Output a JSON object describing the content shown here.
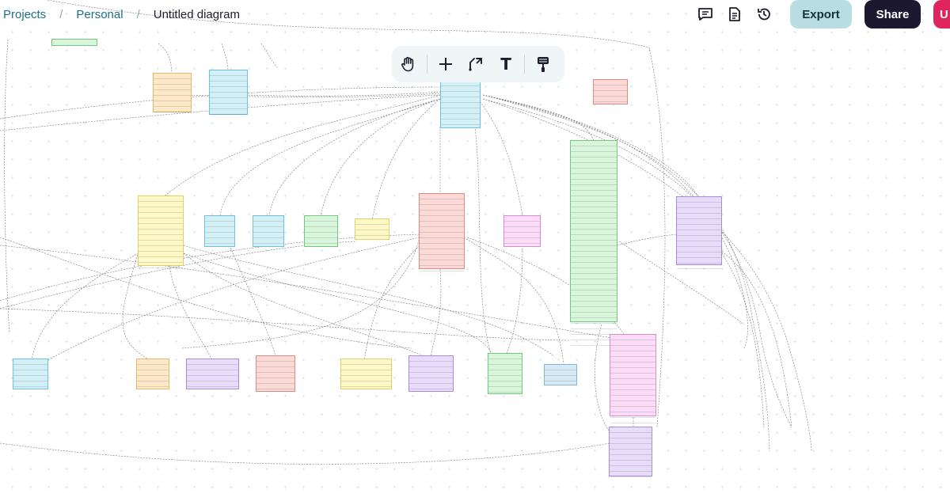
{
  "breadcrumb": {
    "projects": "Projects",
    "separator": "/",
    "personal": "Personal",
    "title": "Untitled diagram"
  },
  "actions": {
    "comments_icon": "comment-icon",
    "notes_icon": "document-icon",
    "history_icon": "history-icon",
    "export_label": "Export",
    "share_label": "Share",
    "user_label": "U"
  },
  "toolbar": {
    "tools": [
      "hand-icon",
      "plus-icon",
      "connector-icon",
      "text-icon",
      "paint-icon"
    ],
    "text_glyph": "T"
  },
  "colors": {
    "export_bg": "#b8dde3",
    "share_bg": "#1b1830",
    "user_bg": "#e0245e",
    "crumb_link": "#1f6f8b",
    "table_palette": [
      "#fde9c8",
      "#d4f0f7",
      "#fbd9d6",
      "#d9f5dc",
      "#fdf8c6",
      "#e8dcfb",
      "#fcdcf6",
      "#d6eaf5"
    ]
  },
  "tables": [
    {
      "id": "t1",
      "color": "#fde9c8",
      "border": "#e8b56c",
      "rows": 7
    },
    {
      "id": "t2",
      "color": "#d4f0f7",
      "border": "#6cc2dc",
      "rows": 8
    },
    {
      "id": "t3",
      "color": "#d4f0f7",
      "border": "#6cc2dc",
      "rows": 9
    },
    {
      "id": "t4",
      "color": "#fbd9d6",
      "border": "#e08a82",
      "rows": 4
    },
    {
      "id": "t5",
      "color": "#d9f5dc",
      "border": "#6fcb7b",
      "rows": 35
    },
    {
      "id": "t6",
      "color": "#e8dcfb",
      "border": "#a98ae0",
      "rows": 12
    },
    {
      "id": "t7",
      "color": "#fdf8c6",
      "border": "#e0d06a",
      "rows": 13
    },
    {
      "id": "t8",
      "color": "#d4f0f7",
      "border": "#6cc2dc",
      "rows": 5
    },
    {
      "id": "t9",
      "color": "#d4f0f7",
      "border": "#6cc2dc",
      "rows": 5
    },
    {
      "id": "t10",
      "color": "#d9f5dc",
      "border": "#6fcb7b",
      "rows": 5
    },
    {
      "id": "t11",
      "color": "#fdf8c6",
      "border": "#e0d06a",
      "rows": 4
    },
    {
      "id": "t12",
      "color": "#fbd9d6",
      "border": "#e08a82",
      "rows": 13
    },
    {
      "id": "t13",
      "color": "#fcdcf6",
      "border": "#dc8ad0",
      "rows": 5
    },
    {
      "id": "t14",
      "color": "#fcdcf6",
      "border": "#dc8ad0",
      "rows": 16
    },
    {
      "id": "t15",
      "color": "#e8dcfb",
      "border": "#a98ae0",
      "rows": 9
    },
    {
      "id": "t16",
      "color": "#d4f0f7",
      "border": "#6cc2dc",
      "rows": 5
    },
    {
      "id": "t17",
      "color": "#fde9c8",
      "border": "#e8b56c",
      "rows": 5
    },
    {
      "id": "t18",
      "color": "#e8dcfb",
      "border": "#a98ae0",
      "rows": 5
    },
    {
      "id": "t19",
      "color": "#fbd9d6",
      "border": "#e08a82",
      "rows": 6
    },
    {
      "id": "t20",
      "color": "#fdf8c6",
      "border": "#e0d06a",
      "rows": 5
    },
    {
      "id": "t21",
      "color": "#e8dcfb",
      "border": "#a98ae0",
      "rows": 6
    },
    {
      "id": "t22",
      "color": "#d9f5dc",
      "border": "#6fcb7b",
      "rows": 7
    },
    {
      "id": "t23",
      "color": "#d6eaf5",
      "border": "#7fb5d6",
      "rows": 3
    },
    {
      "id": "t24",
      "color": "#e8dcfb",
      "border": "#a98ae0",
      "rows": 10
    },
    {
      "id": "t25",
      "color": "#d9f5dc",
      "border": "#6fcb7b",
      "rows": 1
    }
  ]
}
